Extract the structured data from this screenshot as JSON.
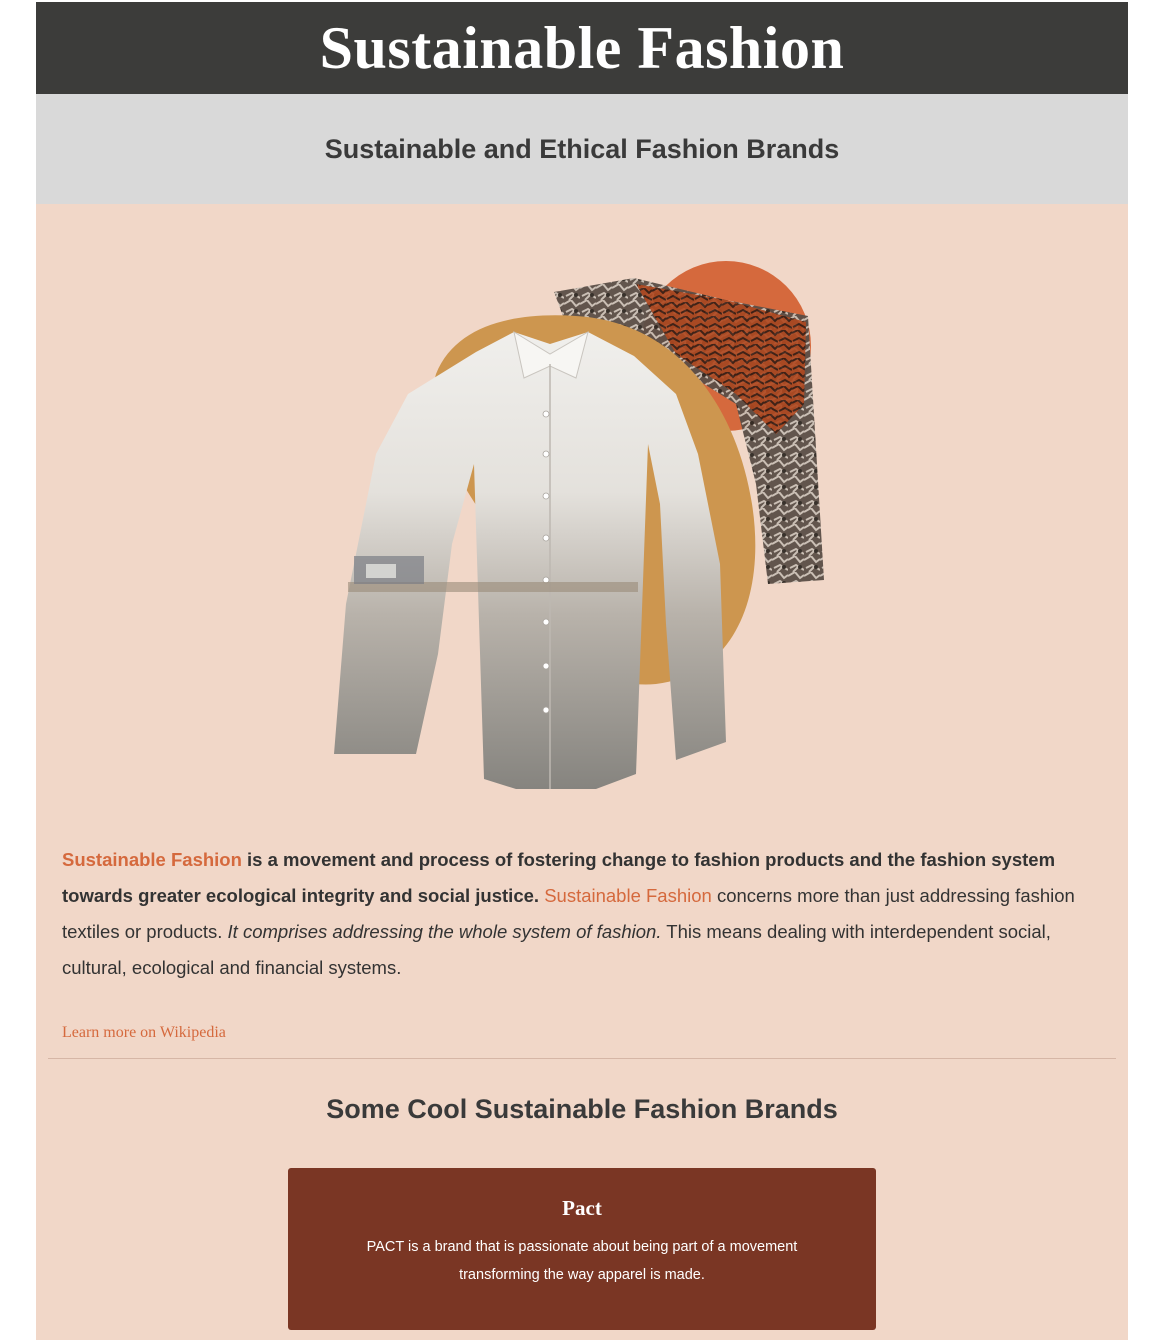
{
  "header": {
    "title": "Sustainable Fashion"
  },
  "subheader": {
    "title": "Sustainable and Ethical Fashion Brands"
  },
  "hero_image": {
    "name": "shirt-collage-image"
  },
  "intro": {
    "bold_link": "Sustainable Fashion",
    "bold_text": " is a movement and process of fostering change to fashion products and the fashion system towards greater ecological integrity and social justice.",
    "link2": "Sustainable Fashion",
    "text2": " concerns more than just addressing fashion textiles or products. ",
    "italic": "It comprises addressing the whole system of fashion.",
    "text3": " This means dealing with interdependent social, cultural, ecological and financial systems."
  },
  "wiki_link": "Learn more on Wikipedia",
  "brands": {
    "title": "Some Cool Sustainable Fashion Brands",
    "items": [
      {
        "name": "Pact",
        "description": "PACT is a brand that is passionate about being part of a movement transforming the way apparel is made."
      }
    ]
  },
  "colors": {
    "header_bg": "#3c3c3a",
    "subheader_bg": "#d9d9d9",
    "page_bg": "#f1d7c8",
    "accent": "#d5693d",
    "card_bg": "#7a3624",
    "blob_orange": "#d5693d",
    "blob_gold": "#cd964f"
  }
}
